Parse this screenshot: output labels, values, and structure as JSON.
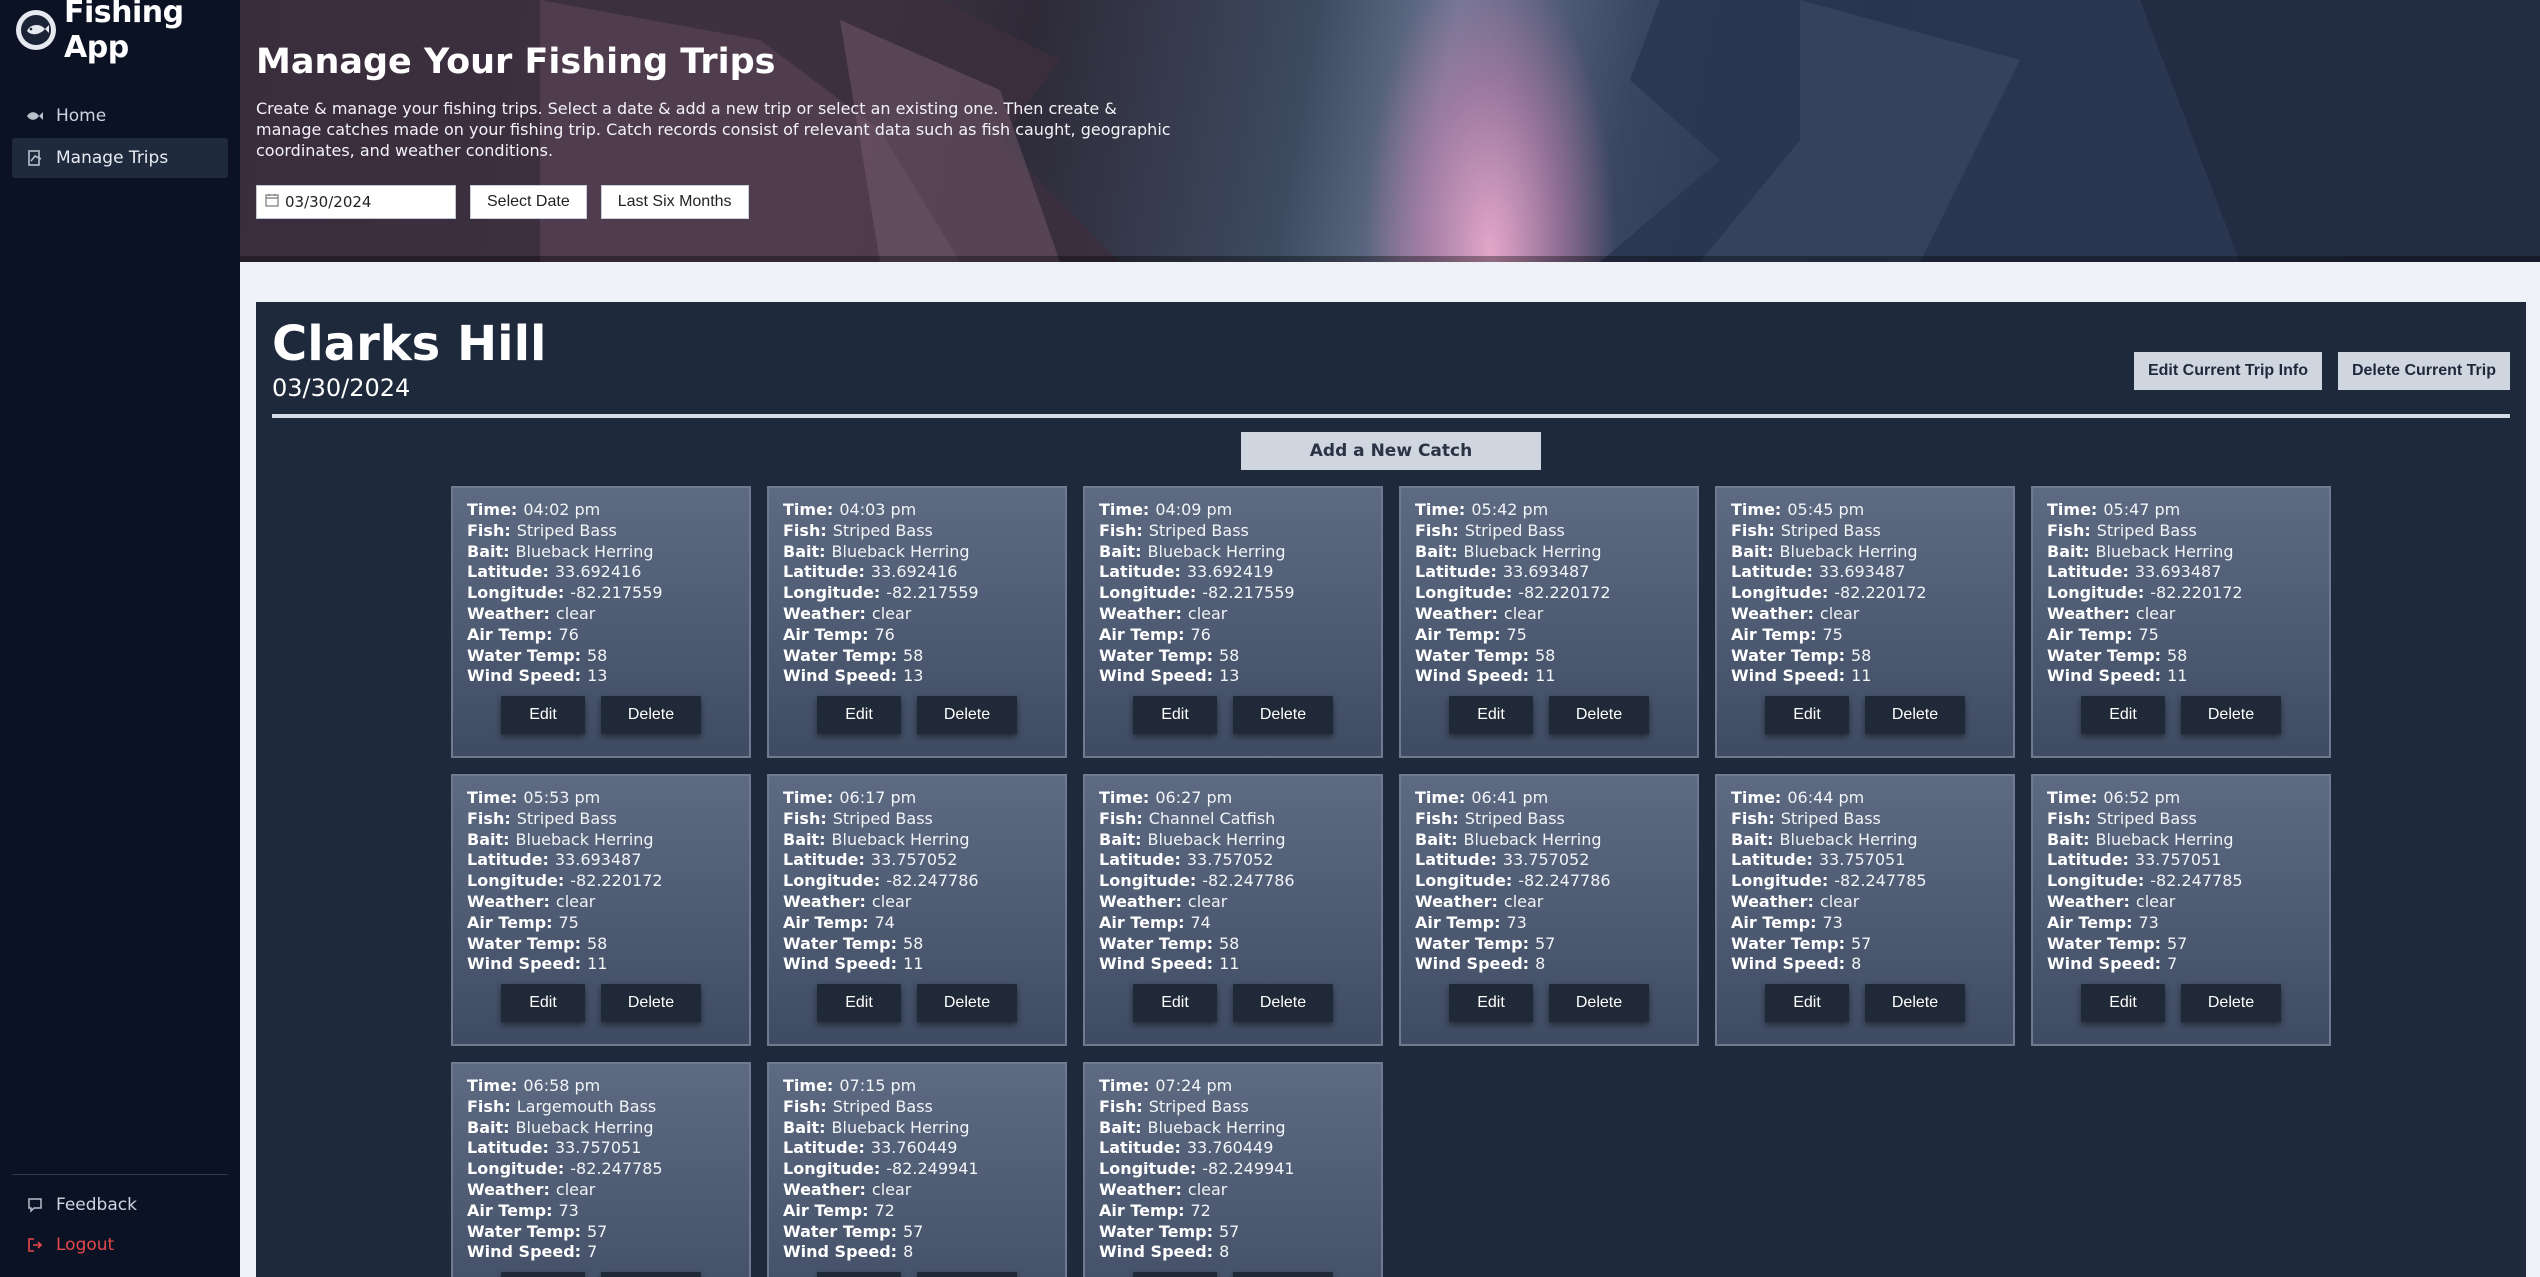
{
  "app": {
    "title": "Fishing App"
  },
  "sidebar": {
    "items": [
      {
        "label": "Home",
        "icon": "fish-icon",
        "active": false
      },
      {
        "label": "Manage Trips",
        "icon": "log-icon",
        "active": true
      }
    ],
    "bottom": [
      {
        "label": "Feedback",
        "icon": "chat-icon"
      },
      {
        "label": "Logout",
        "icon": "logout-icon"
      }
    ]
  },
  "hero": {
    "title": "Manage Your Fishing Trips",
    "description": "Create & manage your fishing trips. Select a date & add a new trip or select an existing one. Then create & manage catches made on your fishing trip. Catch records consist of relevant data such as fish caught, geographic coordinates, and weather conditions.",
    "date_value": "03/30/2024",
    "select_date_label": "Select Date",
    "last_six_months_label": "Last Six Months"
  },
  "trip": {
    "name": "Clarks Hill",
    "date": "03/30/2024",
    "edit_label": "Edit Current Trip Info",
    "delete_label": "Delete Current Trip",
    "add_catch_label": "Add a New Catch"
  },
  "labels": {
    "time": "Time:",
    "fish": "Fish:",
    "bait": "Bait:",
    "latitude": "Latitude:",
    "longitude": "Longitude:",
    "weather": "Weather:",
    "air_temp": "Air Temp:",
    "water_temp": "Water Temp:",
    "wind_speed": "Wind Speed:",
    "edit": "Edit",
    "delete": "Delete"
  },
  "catches": [
    {
      "time": "04:02 pm",
      "fish": "Striped Bass",
      "bait": "Blueback Herring",
      "latitude": "33.692416",
      "longitude": "-82.217559",
      "weather": "clear",
      "air_temp": "76",
      "water_temp": "58",
      "wind_speed": "13"
    },
    {
      "time": "04:03 pm",
      "fish": "Striped Bass",
      "bait": "Blueback Herring",
      "latitude": "33.692416",
      "longitude": "-82.217559",
      "weather": "clear",
      "air_temp": "76",
      "water_temp": "58",
      "wind_speed": "13"
    },
    {
      "time": "04:09 pm",
      "fish": "Striped Bass",
      "bait": "Blueback Herring",
      "latitude": "33.692419",
      "longitude": "-82.217559",
      "weather": "clear",
      "air_temp": "76",
      "water_temp": "58",
      "wind_speed": "13"
    },
    {
      "time": "05:42 pm",
      "fish": "Striped Bass",
      "bait": "Blueback Herring",
      "latitude": "33.693487",
      "longitude": "-82.220172",
      "weather": "clear",
      "air_temp": "75",
      "water_temp": "58",
      "wind_speed": "11"
    },
    {
      "time": "05:45 pm",
      "fish": "Striped Bass",
      "bait": "Blueback Herring",
      "latitude": "33.693487",
      "longitude": "-82.220172",
      "weather": "clear",
      "air_temp": "75",
      "water_temp": "58",
      "wind_speed": "11"
    },
    {
      "time": "05:47 pm",
      "fish": "Striped Bass",
      "bait": "Blueback Herring",
      "latitude": "33.693487",
      "longitude": "-82.220172",
      "weather": "clear",
      "air_temp": "75",
      "water_temp": "58",
      "wind_speed": "11"
    },
    {
      "time": "05:53 pm",
      "fish": "Striped Bass",
      "bait": "Blueback Herring",
      "latitude": "33.693487",
      "longitude": "-82.220172",
      "weather": "clear",
      "air_temp": "75",
      "water_temp": "58",
      "wind_speed": "11"
    },
    {
      "time": "06:17 pm",
      "fish": "Striped Bass",
      "bait": "Blueback Herring",
      "latitude": "33.757052",
      "longitude": "-82.247786",
      "weather": "clear",
      "air_temp": "74",
      "water_temp": "58",
      "wind_speed": "11"
    },
    {
      "time": "06:27 pm",
      "fish": "Channel Catfish",
      "bait": "Blueback Herring",
      "latitude": "33.757052",
      "longitude": "-82.247786",
      "weather": "clear",
      "air_temp": "74",
      "water_temp": "58",
      "wind_speed": "11"
    },
    {
      "time": "06:41 pm",
      "fish": "Striped Bass",
      "bait": "Blueback Herring",
      "latitude": "33.757052",
      "longitude": "-82.247786",
      "weather": "clear",
      "air_temp": "73",
      "water_temp": "57",
      "wind_speed": "8"
    },
    {
      "time": "06:44 pm",
      "fish": "Striped Bass",
      "bait": "Blueback Herring",
      "latitude": "33.757051",
      "longitude": "-82.247785",
      "weather": "clear",
      "air_temp": "73",
      "water_temp": "57",
      "wind_speed": "8"
    },
    {
      "time": "06:52 pm",
      "fish": "Striped Bass",
      "bait": "Blueback Herring",
      "latitude": "33.757051",
      "longitude": "-82.247785",
      "weather": "clear",
      "air_temp": "73",
      "water_temp": "57",
      "wind_speed": "7"
    },
    {
      "time": "06:58 pm",
      "fish": "Largemouth Bass",
      "bait": "Blueback Herring",
      "latitude": "33.757051",
      "longitude": "-82.247785",
      "weather": "clear",
      "air_temp": "73",
      "water_temp": "57",
      "wind_speed": "7"
    },
    {
      "time": "07:15 pm",
      "fish": "Striped Bass",
      "bait": "Blueback Herring",
      "latitude": "33.760449",
      "longitude": "-82.249941",
      "weather": "clear",
      "air_temp": "72",
      "water_temp": "57",
      "wind_speed": "8"
    },
    {
      "time": "07:24 pm",
      "fish": "Striped Bass",
      "bait": "Blueback Herring",
      "latitude": "33.760449",
      "longitude": "-82.249941",
      "weather": "clear",
      "air_temp": "72",
      "water_temp": "57",
      "wind_speed": "8"
    }
  ],
  "colors": {
    "sidebar_bg": "#0b1224",
    "panel_bg": "#1e293b",
    "card_bg": "#55627a",
    "logout": "#e5484d"
  }
}
